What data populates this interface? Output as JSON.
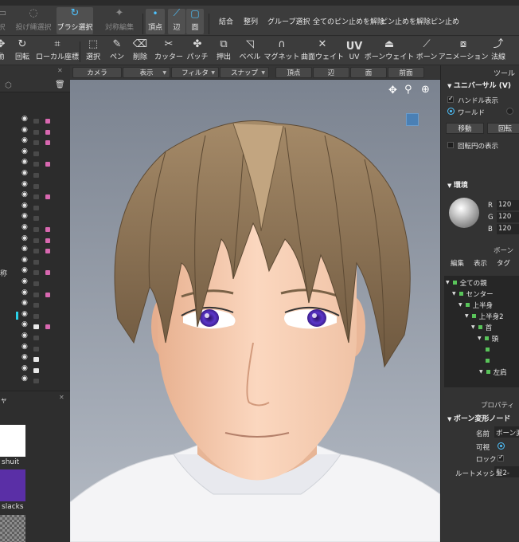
{
  "toolbar_select": {
    "lasso_label": "投げ縄選択",
    "brush_label": "ブラシ選択",
    "symmetry_label": "対称編集",
    "vertex_label": "頂点",
    "edge_label": "辺",
    "face_label": "面",
    "commands": [
      "結合",
      "整列",
      "グループ選択",
      "全てのピン止めを解除",
      "ピン止めを解除",
      "ピン止め"
    ]
  },
  "toolbar_tools": {
    "items": [
      {
        "label": "回転",
        "icon": "rotate-icon"
      },
      {
        "label": "ローカル座標",
        "icon": "local-coord-icon"
      },
      {
        "label": "選択",
        "icon": "select-icon"
      },
      {
        "label": "ペン",
        "icon": "pen-icon"
      },
      {
        "label": "削除",
        "icon": "eraser-icon"
      },
      {
        "label": "カッター",
        "icon": "cutter-icon"
      },
      {
        "label": "パッチ",
        "icon": "patch-icon"
      },
      {
        "label": "押出",
        "icon": "extrude-icon"
      },
      {
        "label": "ベベル",
        "icon": "bevel-icon"
      },
      {
        "label": "マグネット",
        "icon": "magnet-icon"
      },
      {
        "label": "曲面ウェイト",
        "icon": "surface-weight-icon"
      },
      {
        "label": "UV",
        "icon": "uv-icon"
      },
      {
        "label": "ボーンウェイト",
        "icon": "bone-weight-icon"
      },
      {
        "label": "ボーン",
        "icon": "bone-icon"
      },
      {
        "label": "アニメーション",
        "icon": "animation-icon"
      },
      {
        "label": "法線",
        "icon": "normal-icon"
      }
    ]
  },
  "viewport_toolbar": {
    "camera": "カメラ",
    "display": "表示",
    "filter": "フィルタ",
    "snap": "スナップ",
    "vertex": "頂点",
    "edge": "辺",
    "face": "面",
    "front": "前面"
  },
  "left_panel": {
    "side_label": "称",
    "materials": [
      "shuit",
      "slacks"
    ],
    "material_header": "ャ",
    "swatch_colors": [
      "#ffffff",
      "#5a2fa6"
    ]
  },
  "right_panel": {
    "tool_title": "ツール",
    "universal_title": "ユニバーサル (V)",
    "handle_display": "ハンドル表示",
    "world": "ワールド",
    "move": "移動",
    "rotate": "回転",
    "rotation_circle": "回転円の表示",
    "environment": "環境",
    "r_label": "R",
    "g_label": "G",
    "b_label": "B",
    "r_value": "120",
    "g_value": "120",
    "b_value": "120",
    "bone_title": "ボーン",
    "bone_tabs": [
      "編集",
      "表示",
      "タグ"
    ],
    "tree": [
      "全ての親",
      "センター",
      "上半身",
      "上半身2",
      "首",
      "頭",
      "左肩"
    ],
    "properties_title": "プロパティ",
    "bone_transform_node": "ボーン変形ノード",
    "name_label": "名前",
    "name_value": "ボーン変",
    "visible_label": "可視",
    "lock_label": "ロック",
    "root_mesh_label": "ルートメッシュ",
    "root_mesh_value": "髪2-"
  },
  "colors": {
    "accent": "#4ec3ff",
    "bone_green": "#59c45a",
    "lock_pink": "#d868b0"
  }
}
